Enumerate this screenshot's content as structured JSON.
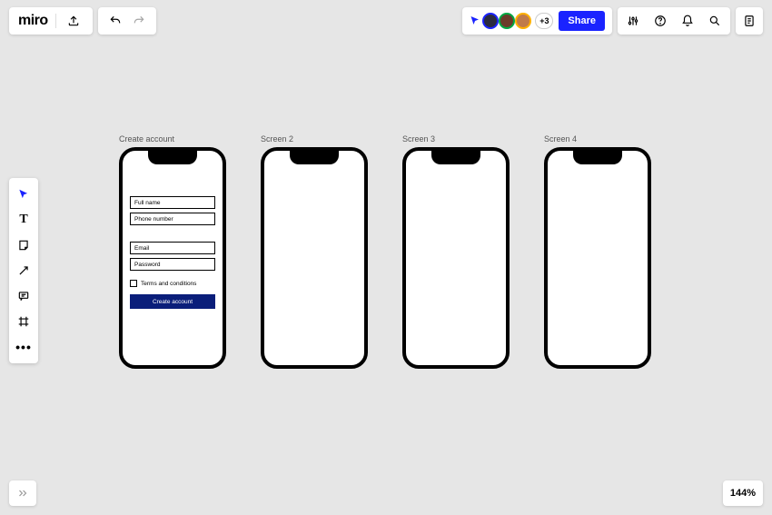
{
  "brand": "miro",
  "share_label": "Share",
  "extra_avatars": "+3",
  "avatars": [
    {
      "border": "#1a23ff",
      "bg": "#2b2b40"
    },
    {
      "border": "#00a843",
      "bg": "#6b3b2a"
    },
    {
      "border": "#ffb000",
      "bg": "#c07a4a"
    }
  ],
  "zoom": "144%",
  "frames": {
    "f1": {
      "label": "Create account"
    },
    "f2": {
      "label": "Screen 2"
    },
    "f3": {
      "label": "Screen 3"
    },
    "f4": {
      "label": "Screen 4"
    }
  },
  "form": {
    "full_name": "Full name",
    "phone": "Phone number",
    "email": "Email",
    "password": "Password",
    "terms": "Terms and conditions",
    "cta": "Create account"
  }
}
